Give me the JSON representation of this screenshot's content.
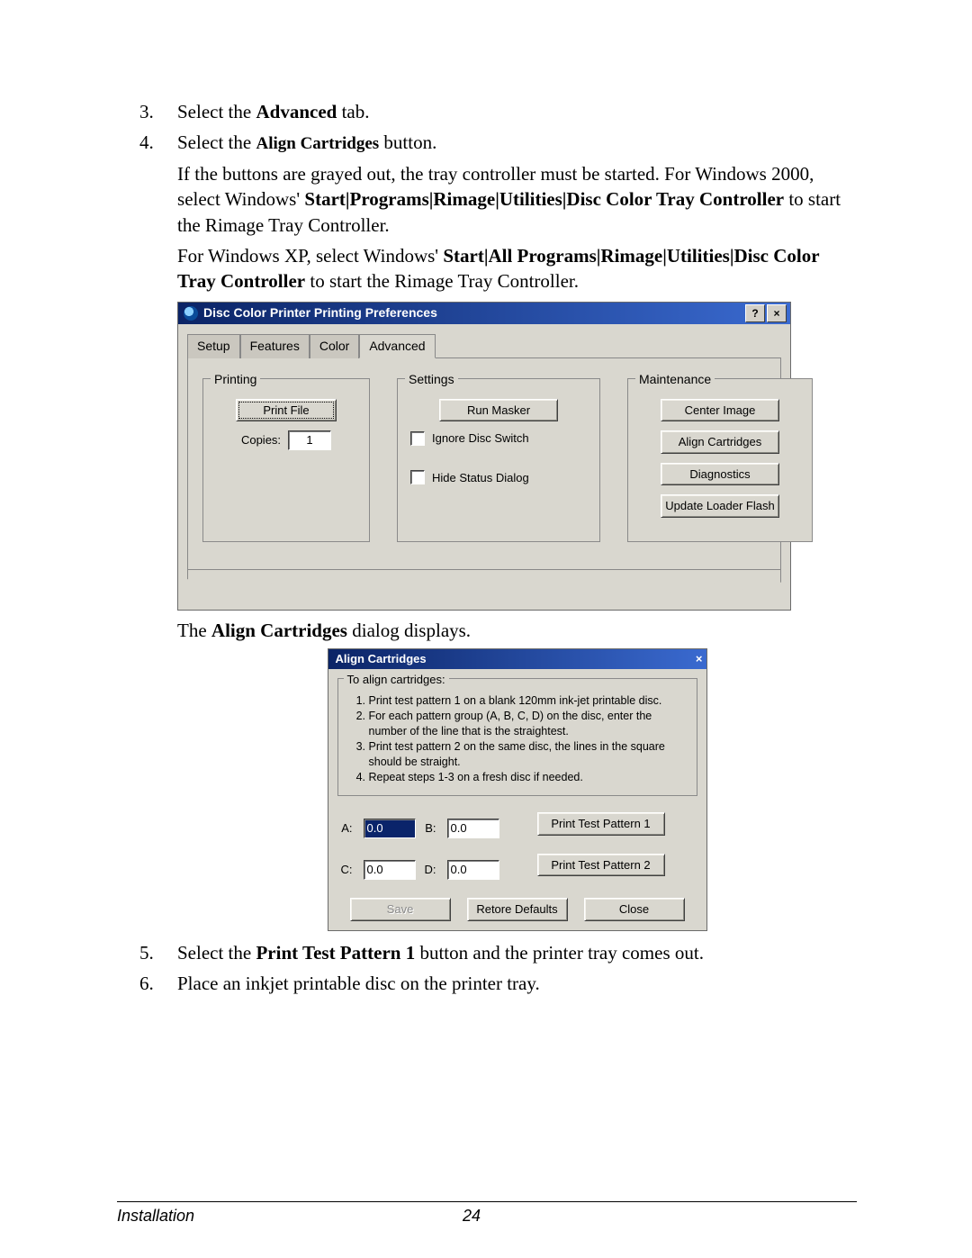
{
  "steps": {
    "s3": {
      "num": "3.",
      "pre": "Select the ",
      "bold": "Advanced",
      "post": " tab."
    },
    "s4": {
      "num": "4.",
      "pre": "Select the ",
      "bold": "Align Cartridges",
      "post": " button."
    },
    "s5": {
      "num": "5.",
      "pre": "Select the ",
      "bold": "Print Test Pattern 1",
      "post": " button and the printer tray comes out."
    },
    "s6": {
      "num": "6.",
      "text": "Place an inkjet printable disc on the printer tray."
    }
  },
  "para1": {
    "a": "If the buttons are grayed out, the tray controller must be started. For Windows 2000, s",
    "b": "elect ",
    "c": "Windows' ",
    "bold": "Start|Programs|Rimage|Utilities|Disc Color Tray Controller",
    "d": " to start the Rimage Tray Controller."
  },
  "para2": {
    "a": "For Windows XP, s",
    "b": "elect Windows' ",
    "bold": "Start|All Programs|Rimage|Utilities|Disc Color Tray Controller",
    "c": " to start the Rimage Tray Controller."
  },
  "after_prefs": {
    "pre": "The ",
    "bold": "Align Cartridges",
    "post": " dialog displays."
  },
  "prefs": {
    "title": "Disc Color Printer Printing Preferences",
    "help_btn": "?",
    "close_btn": "×",
    "tabs": {
      "setup": "Setup",
      "features": "Features",
      "color": "Color",
      "advanced": "Advanced"
    },
    "grp_printing": "Printing",
    "print_file_btn": " Print File ",
    "copies_label": "Copies:",
    "copies_value": "1",
    "grp_settings": "Settings",
    "run_masker_btn": "Run Masker",
    "ignore_disc": "Ignore Disc Switch",
    "hide_status": "Hide Status Dialog",
    "grp_maint": "Maintenance",
    "center_image_btn": "Center Image",
    "align_btn": "Align Cartridges",
    "diag_btn": "Diagnostics",
    "loader_btn": "Update Loader Flash"
  },
  "align": {
    "title": "Align Cartridges",
    "close_btn": "×",
    "legend": "To align cartridges:",
    "step1": "Print test pattern 1 on a blank 120mm ink-jet printable disc.",
    "step2": "For each pattern group (A, B, C, D) on the disc, enter the number of the line that is the straightest.",
    "step3": "Print test pattern 2 on the same disc, the lines in the square should be straight.",
    "step4": "Repeat steps 1-3 on a fresh disc if needed.",
    "A_label": "A:",
    "A_val": "0.0",
    "B_label": "B:",
    "B_val": "0.0",
    "C_label": "C:",
    "C_val": "0.0",
    "D_label": "D:",
    "D_val": "0.0",
    "pattern1_btn": "Print Test Pattern 1",
    "pattern2_btn": "Print Test Pattern 2",
    "save_btn": "Save",
    "retore_btn": "Retore Defaults",
    "close_btn2": "Close"
  },
  "footer": {
    "section": "Installation",
    "page": "24"
  }
}
